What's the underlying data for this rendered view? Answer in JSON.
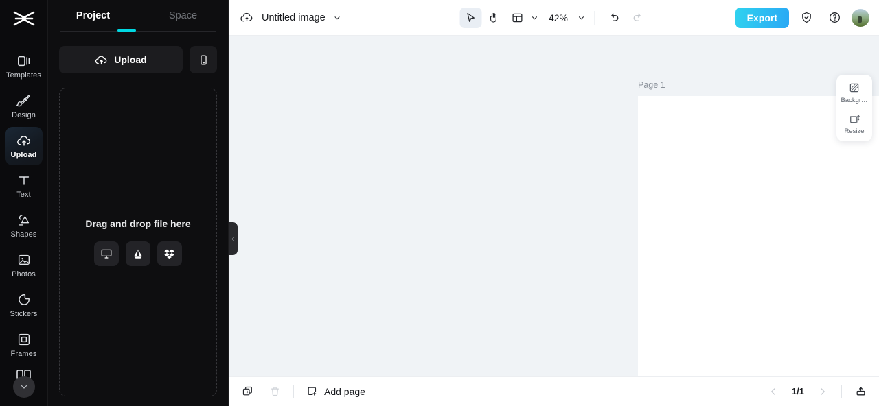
{
  "rail": {
    "logo_icon": "capcut-logo-icon",
    "items": [
      {
        "label": "Templates",
        "icon": "templates-icon",
        "active": false
      },
      {
        "label": "Design",
        "icon": "design-icon",
        "active": false
      },
      {
        "label": "Upload",
        "icon": "upload-cloud-icon",
        "active": true
      },
      {
        "label": "Text",
        "icon": "text-icon",
        "active": false
      },
      {
        "label": "Shapes",
        "icon": "shapes-icon",
        "active": false
      },
      {
        "label": "Photos",
        "icon": "photos-icon",
        "active": false
      },
      {
        "label": "Stickers",
        "icon": "stickers-icon",
        "active": false
      },
      {
        "label": "Frames",
        "icon": "frames-icon",
        "active": false
      }
    ],
    "more_icon": "chevron-down-icon",
    "active_accent": "#1b2836"
  },
  "panel": {
    "tabs": [
      {
        "label": "Project",
        "active": true
      },
      {
        "label": "Space",
        "active": false
      }
    ],
    "tab_indicator_color": "#00d8e2",
    "upload_button": {
      "label": "Upload",
      "icon": "upload-cloud-icon"
    },
    "phone_button": {
      "icon": "mobile-phone-icon"
    },
    "dropzone": {
      "text": "Drag and drop file here",
      "sources": [
        {
          "name": "computer",
          "icon": "monitor-icon"
        },
        {
          "name": "google-drive",
          "icon": "google-drive-icon"
        },
        {
          "name": "dropbox",
          "icon": "dropbox-icon"
        }
      ]
    }
  },
  "topbar": {
    "cloud_icon": "cloud-sync-icon",
    "doc_title": "Untitled image",
    "title_caret_icon": "chevron-down-icon",
    "tools": [
      {
        "name": "select-tool",
        "icon": "cursor-arrow-icon",
        "selected": true
      },
      {
        "name": "hand-tool",
        "icon": "hand-icon",
        "selected": false
      },
      {
        "name": "layout-tool",
        "icon": "layout-panel-icon",
        "selected": false
      }
    ],
    "layout_caret_icon": "chevron-down-icon",
    "zoom_level": "42%",
    "zoom_caret_icon": "chevron-down-icon",
    "undo_icon": "undo-arrow-icon",
    "redo_icon": "redo-arrow-icon",
    "export_label": "Export",
    "export_color": "#2aa8f5",
    "shield_icon": "shield-check-icon",
    "help_icon": "question-circle-icon",
    "avatar_name": "user-avatar"
  },
  "canvas": {
    "page_label": "Page 1",
    "duplicate_icon": "duplicate-page-icon",
    "more_icon": "more-horizontal-icon",
    "background_color": "#f0f3f6",
    "sheet_color": "#ffffff",
    "collapse_icon": "chevron-left-icon"
  },
  "float_panel": {
    "items": [
      {
        "label": "Backgr…",
        "icon": "background-pattern-icon"
      },
      {
        "label": "Resize",
        "icon": "resize-icon"
      }
    ]
  },
  "bottombar": {
    "duplicate_icon": "duplicate-page-icon",
    "delete_icon": "trash-icon",
    "add_page_label": "Add page",
    "add_page_icon": "add-page-icon",
    "prev_icon": "chevron-left-icon",
    "page_indicator": "1/1",
    "next_icon": "chevron-right-icon",
    "export_tray_icon": "export-tray-icon"
  }
}
